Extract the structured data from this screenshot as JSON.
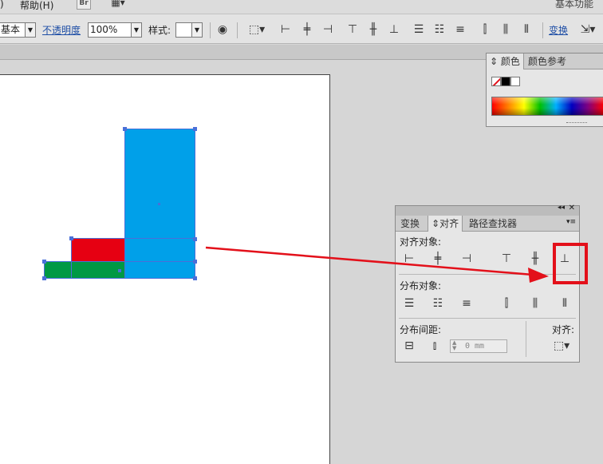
{
  "menu": {
    "paren": ")",
    "help": "帮助(H)",
    "bridge": "Br",
    "workspace": "基本功能"
  },
  "control_bar": {
    "stroke_profile": "基本",
    "opacity_label": "不透明度",
    "opacity_value": "100%",
    "style_label": "样式:",
    "transform_link": "变换"
  },
  "color_panel": {
    "tabs": [
      "颜色",
      "颜色参考"
    ]
  },
  "align_panel": {
    "tabs": [
      "变换",
      "对齐",
      "路径查找器"
    ],
    "align_objects_label": "对齐对象:",
    "distribute_objects_label": "分布对象:",
    "distribute_spacing_label": "分布间距:",
    "align_to_label": "对齐:",
    "spacing_value": "0 mm"
  },
  "colors": {
    "blue_rect": "#00a0e9",
    "red_rect": "#e60012",
    "green_rect": "#009944",
    "selection": "#4a6fd8",
    "highlight": "#e3101a"
  }
}
